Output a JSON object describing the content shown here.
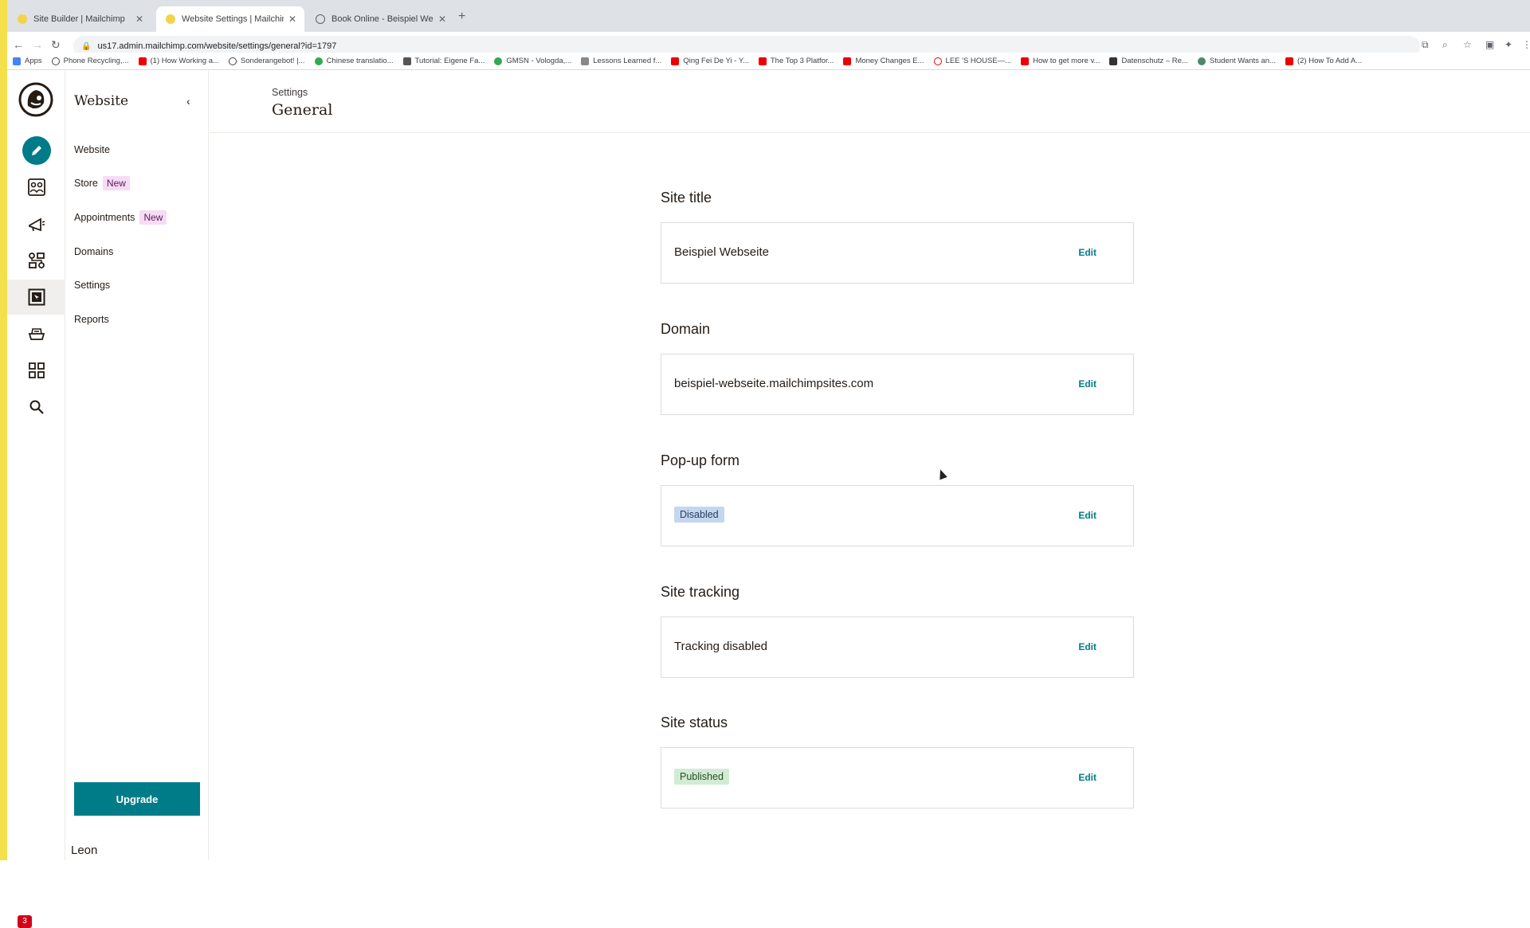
{
  "browser": {
    "tabs": [
      {
        "title": "Site Builder | Mailchimp",
        "active": false
      },
      {
        "title": "Website Settings | Mailchimp",
        "active": true
      },
      {
        "title": "Book Online - Beispiel Websei",
        "active": false
      }
    ],
    "url": "us17.admin.mailchimp.com/website/settings/general?id=1797",
    "bookmarks": [
      "Apps",
      "Phone Recycling,...",
      "(1) How Working a...",
      "Sonderangebot! |...",
      "Chinese translatio...",
      "Tutorial: Eigene Fa...",
      "GMSN - Vologda,...",
      "Lessons Learned f...",
      "Qing Fei De Yi - Y...",
      "The Top 3 Platfor...",
      "Money Changes E...",
      "LEE 'S HOUSE—...",
      "How to get more v...",
      "Datenschutz – Re...",
      "Student Wants an...",
      "(2) How To Add A..."
    ]
  },
  "sidebar": {
    "title": "Website",
    "items": [
      {
        "label": "Website"
      },
      {
        "label": "Store",
        "badge": "New"
      },
      {
        "label": "Appointments",
        "badge": "New"
      },
      {
        "label": "Domains"
      },
      {
        "label": "Settings"
      },
      {
        "label": "Reports"
      }
    ],
    "upgrade_label": "Upgrade",
    "user_name": "Leon",
    "notification_count": "3"
  },
  "page": {
    "breadcrumb": "Settings",
    "title": "General"
  },
  "sections": [
    {
      "label": "Site title",
      "value": "Beispiel Webseite",
      "edit": "Edit"
    },
    {
      "label": "Domain",
      "value": "beispiel-webseite.mailchimpsites.com",
      "edit": "Edit"
    },
    {
      "label": "Pop-up form",
      "value": "Disabled",
      "edit": "Edit"
    },
    {
      "label": "Site tracking",
      "value": "Tracking disabled",
      "edit": "Edit"
    },
    {
      "label": "Site status",
      "value": "Published",
      "edit": "Edit"
    }
  ],
  "colors": {
    "accent": "#007c89",
    "new_badge": "#f6dcf5",
    "disabled_pill": "#c4d7f0",
    "published_pill": "#d2ecd3"
  }
}
